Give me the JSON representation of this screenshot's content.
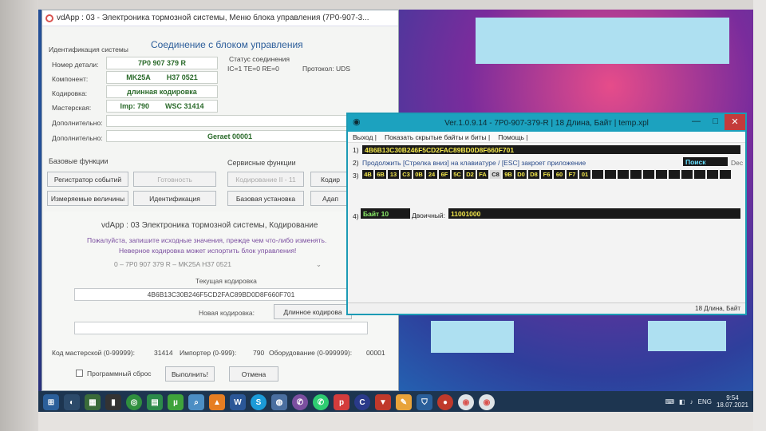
{
  "colors": {
    "hex_accent": "#1ca2bf",
    "hex_bar_bg": "#1a1a1a",
    "hex_bar_text": "#f4e84a",
    "vd_title_blue": "#2b5d9a",
    "vd_value_green": "#2a6a2a",
    "taskbar": "#1d3550"
  },
  "vdapp": {
    "title": "vdApp : 03 - Электроника тормозной системы,  Меню блока управления (7P0-907-3...",
    "section_title": "Соединение с блоком управления",
    "identification_label": "Идентификация системы",
    "fields": [
      {
        "label": "Номер детали:",
        "value": "7P0 907 379 R",
        "value2": ""
      },
      {
        "label": "Компонент:",
        "value": "MK25A",
        "value2": "H37 0521"
      },
      {
        "label": "Кодировка:",
        "value": "длинная кодировка",
        "value2": ""
      },
      {
        "label": "Мастерская:",
        "value": "Imp: 790",
        "value2": "WSC 31414"
      },
      {
        "label": "Дополнительно:",
        "value": "",
        "value2": ""
      },
      {
        "label": "Дополнительно:",
        "value": "Geraet 00001",
        "value2": ""
      }
    ],
    "status": {
      "label": "Статус соединения",
      "values": "IC=1  TE=0  RE=0",
      "protocol": "Протокол: UDS"
    },
    "basic_functions_label": "Базовые функции",
    "service_functions_label": "Сервисные функции",
    "buttons": {
      "event_log": "Регистратор событий",
      "readiness": "Готовность",
      "coding2": "Кодирование II - 11",
      "coding_cut": "Кодир",
      "measured": "Измеряемые величины",
      "identification": "Идентификация",
      "basic_setting": "Базовая установка",
      "adapt_cut": "Адап"
    },
    "coding_dialog": {
      "title": "vdApp : 03  Электроника тормозной системы,  Кодирование",
      "warning1": "Пожалуйста, запишите исходные значения, прежде чем что-либо изменять.",
      "warning2": "Неверное кодировка может испортить блок управления!",
      "select_value": "0 – 7P0 907 379 R – MK25A        H37 0521",
      "current_label": "Текущая кодировка",
      "current_value": "4B6B13C30B246F5CD2FAC89BD0D8F660F701",
      "new_label": "Новая кодировка:",
      "long_coding_button": "Длинное кодирова",
      "workshop_label": "Код мастерской (0-99999):",
      "workshop_value": "31414",
      "importer_label": "Импортер (0-999):",
      "importer_value": "790",
      "equipment_label": "Оборудование (0-999999):",
      "equipment_value": "00001",
      "reset_label": "Программный сброс",
      "execute_button": "Выполнить!",
      "cancel_button": "Отмена"
    }
  },
  "hexeditor": {
    "title": "Ver.1.0.9.14 - 7P0-907-379-R | 18 Длина, Байт | temp.xpl",
    "menu": [
      "Выход |",
      "Показать скрытые байты и биты |",
      "Помощь |"
    ],
    "row1_num": "1)",
    "row1_value": "4B6B13C30B246F5CD2FAC89BD0D8F660F701",
    "row2_num": "2)",
    "row2_text": "Продолжить [Стрелка вниз] на клавиатуре / [ESC] закроет приложение",
    "search_label": "Поиск",
    "dec_label": "Dec",
    "row3_num": "3)",
    "bytes": [
      "4B",
      "6B",
      "13",
      "C3",
      "0B",
      "24",
      "6F",
      "5C",
      "D2",
      "FA",
      "C8",
      "9B",
      "D0",
      "D8",
      "F6",
      "60",
      "F7",
      "01"
    ],
    "row4_num": "4)",
    "byte_label": "Байт 10",
    "binary_label": "Двоичный:",
    "binary_value": "11001000",
    "status": "18 Длина, Байт"
  },
  "taskbar": {
    "icons": [
      "windows-icon",
      "back-icon",
      "explorer-icon",
      "media-icon",
      "chrome-icon",
      "calculator-icon",
      "utorrent-icon",
      "search-tool-icon",
      "vlc-icon",
      "word-icon",
      "skype-icon",
      "network-icon",
      "viber-icon",
      "whatsapp-icon",
      "p-app-icon",
      "c-app-icon",
      "pdf-icon",
      "paint-icon",
      "shield-icon",
      "disk-icon",
      "vdapp-icon",
      "vdapp2-icon"
    ],
    "lang": "ENG",
    "time": "9:54",
    "date": "18.07.2021"
  }
}
